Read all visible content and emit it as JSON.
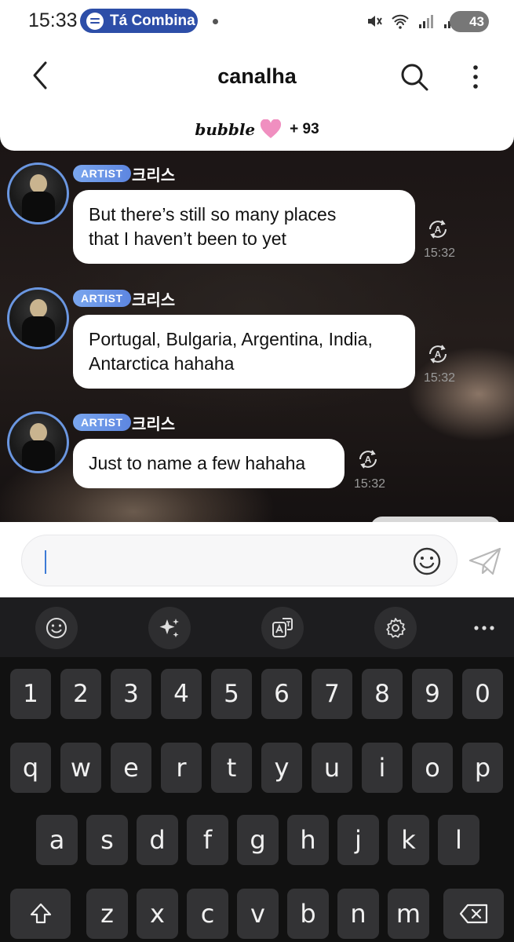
{
  "status_bar": {
    "time": "15:33",
    "now_playing": "Tá Combina",
    "battery": "43",
    "icons": [
      "mute-icon",
      "wifi-icon",
      "signal-icon",
      "signal-icon"
    ]
  },
  "header": {
    "title": "canalha",
    "bubble_brand": "bubble",
    "bubble_count": "+ 93"
  },
  "messages": [
    {
      "badge": "ARTIST",
      "sender": "크리스",
      "text_line1": "But there’s still so many places",
      "text_line2": "that I haven’t been to yet",
      "time": "15:32"
    },
    {
      "badge": "ARTIST",
      "sender": "크리스",
      "text_line1": "Portugal, Bulgaria, Argentina, India,",
      "text_line2": "Antarctica hahaha",
      "time": "15:32"
    },
    {
      "badge": "ARTIST",
      "sender": "크리스",
      "text_line1": "Just to name a few hahaha",
      "text_line2": "",
      "time": "15:32"
    }
  ],
  "input": {
    "value": "",
    "placeholder": ""
  },
  "keyboard": {
    "toolbar": [
      "emoji-icon",
      "ai-sparkle-icon",
      "translate-icon",
      "settings-icon",
      "more-icon"
    ],
    "numbers": [
      "1",
      "2",
      "3",
      "4",
      "5",
      "6",
      "7",
      "8",
      "9",
      "0"
    ],
    "row1": [
      "q",
      "w",
      "e",
      "r",
      "t",
      "y",
      "u",
      "i",
      "o",
      "p"
    ],
    "row2": [
      "a",
      "s",
      "d",
      "f",
      "g",
      "h",
      "j",
      "k",
      "l"
    ],
    "row3": [
      "z",
      "x",
      "c",
      "v",
      "b",
      "n",
      "m"
    ]
  },
  "colors": {
    "accent": "#5d86e0",
    "spotify_pill": "#2d4ea8",
    "keyboard_bg": "#111111",
    "key_bg": "#333335",
    "heart": "#f08fc0"
  }
}
